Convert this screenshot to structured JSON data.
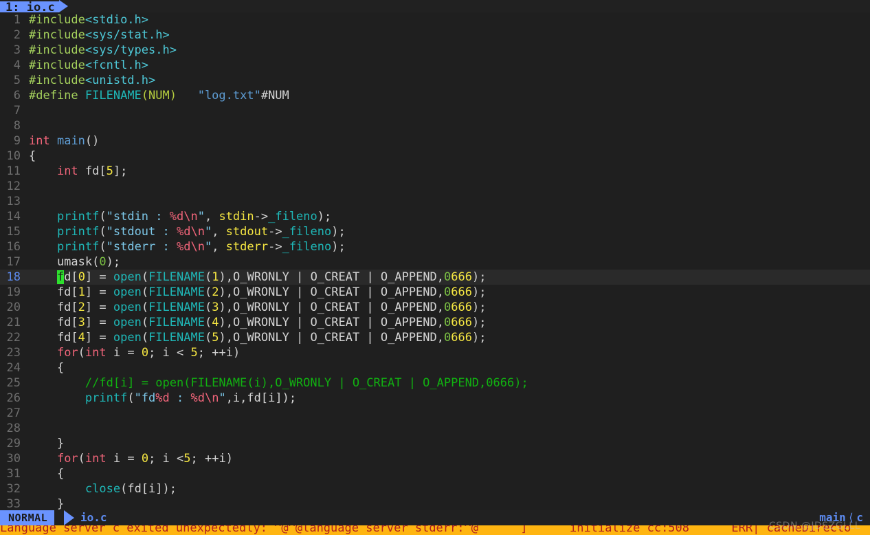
{
  "window": {
    "title": "io.c",
    "background": "#1f1f1f",
    "accent": "#6a93ff",
    "cursor_color": "#2ee02e",
    "error_bar_bg": "#ffb511",
    "error_bar_fg": "#b02020"
  },
  "tabline": {
    "tabs": [
      {
        "index": "1:",
        "name": "io.c",
        "active": true
      }
    ]
  },
  "editor": {
    "filename": "io.c",
    "cursor_line": 18,
    "cursor_col": 5,
    "cursor_char": "f",
    "first_visible_line": 1,
    "last_visible_line": 33,
    "lines": [
      {
        "n": "1",
        "text": "#include<stdio.h>"
      },
      {
        "n": "2",
        "text": "#include<sys/stat.h>"
      },
      {
        "n": "3",
        "text": "#include<sys/types.h>"
      },
      {
        "n": "4",
        "text": "#include<fcntl.h>"
      },
      {
        "n": "5",
        "text": "#include<unistd.h>"
      },
      {
        "n": "6",
        "text": "#define FILENAME(NUM)   \"log.txt\"#NUM"
      },
      {
        "n": "7",
        "text": ""
      },
      {
        "n": "8",
        "text": ""
      },
      {
        "n": "9",
        "text": "int main()"
      },
      {
        "n": "10",
        "text": "{"
      },
      {
        "n": "11",
        "text": "    int fd[5];"
      },
      {
        "n": "12",
        "text": ""
      },
      {
        "n": "13",
        "text": ""
      },
      {
        "n": "14",
        "text": "    printf(\"stdin : %d\\n\", stdin->_fileno);"
      },
      {
        "n": "15",
        "text": "    printf(\"stdout : %d\\n\", stdout->_fileno);"
      },
      {
        "n": "16",
        "text": "    printf(\"stderr : %d\\n\", stderr->_fileno);"
      },
      {
        "n": "17",
        "text": "    umask(0);"
      },
      {
        "n": "18",
        "text": "    fd[0] = open(FILENAME(1),O_WRONLY | O_CREAT | O_APPEND,0666);"
      },
      {
        "n": "19",
        "text": "    fd[1] = open(FILENAME(2),O_WRONLY | O_CREAT | O_APPEND,0666);"
      },
      {
        "n": "20",
        "text": "    fd[2] = open(FILENAME(3),O_WRONLY | O_CREAT | O_APPEND,0666);"
      },
      {
        "n": "21",
        "text": "    fd[3] = open(FILENAME(4),O_WRONLY | O_CREAT | O_APPEND,0666);"
      },
      {
        "n": "22",
        "text": "    fd[4] = open(FILENAME(5),O_WRONLY | O_CREAT | O_APPEND,0666);"
      },
      {
        "n": "23",
        "text": "    for(int i = 0; i < 5; ++i)"
      },
      {
        "n": "24",
        "text": "    {"
      },
      {
        "n": "25",
        "text": "        //fd[i] = open(FILENAME(i),O_WRONLY | O_CREAT | O_APPEND,0666);"
      },
      {
        "n": "26",
        "text": "        printf(\"fd%d : %d\\n\",i,fd[i]);"
      },
      {
        "n": "27",
        "text": ""
      },
      {
        "n": "28",
        "text": ""
      },
      {
        "n": "29",
        "text": "    }"
      },
      {
        "n": "30",
        "text": "    for(int i = 0; i <5; ++i)"
      },
      {
        "n": "31",
        "text": "    {"
      },
      {
        "n": "32",
        "text": "        close(fd[i]);"
      },
      {
        "n": "33",
        "text": "    }"
      }
    ]
  },
  "statusline": {
    "mode": "NORMAL",
    "filename": "io.c",
    "right_symbol": "main",
    "right_chevron": "⟨",
    "right_filetype": "c"
  },
  "message": {
    "text": "Language server c exited unexpectedly: ^@^@language server stderr:^@      ]      initialize cc:508      ERR| cacheDirecto"
  },
  "watermark": {
    "text": "CSDN @JDSZGLLL"
  }
}
